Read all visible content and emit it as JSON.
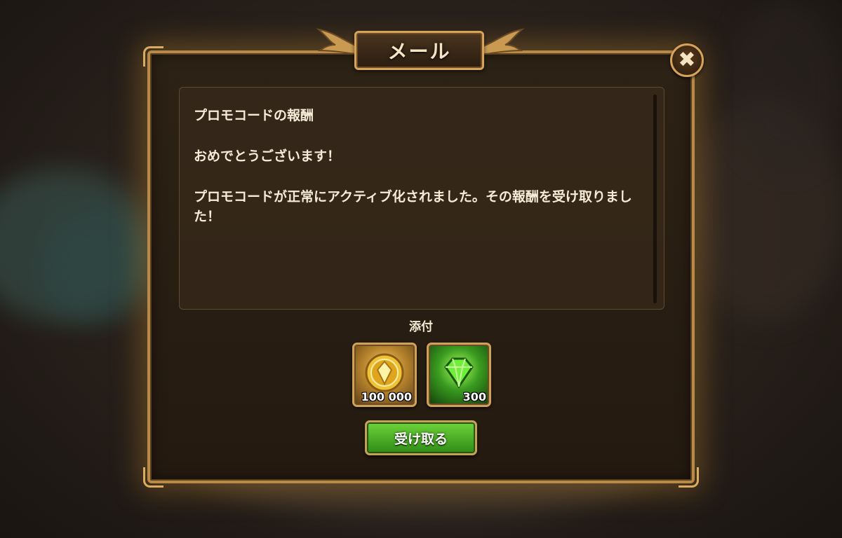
{
  "window": {
    "title": "メール",
    "close_icon": "close-x-icon"
  },
  "message": {
    "heading": "プロモコードの報酬",
    "greeting": "おめでとうございます！",
    "body": "プロモコードが正常にアクティブ化されました。その報酬を受け取りました！"
  },
  "attachments": {
    "label": "添付",
    "items": [
      {
        "icon": "gold-coin-icon",
        "quantity": "100 000"
      },
      {
        "icon": "green-emerald-icon",
        "quantity": "300"
      }
    ]
  },
  "actions": {
    "claim_label": "受け取る"
  },
  "colors": {
    "frame_gold": "#b88a4a",
    "claim_green": "#4cb628",
    "text_cream": "#f6ecd6"
  }
}
